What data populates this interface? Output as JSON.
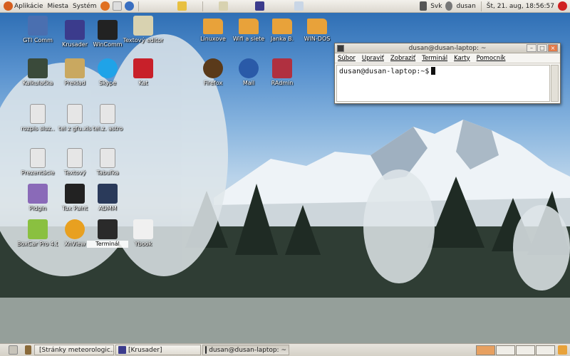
{
  "top_panel": {
    "menus": [
      "Aplikácie",
      "Miesta",
      "Systém"
    ],
    "keyboard_layout": "Svk",
    "user": "dusan",
    "clock": "Št, 21. aug, 18:56:57"
  },
  "desktop": {
    "icons": [
      {
        "label": "GTI Comm",
        "icon": "gti-comm-icon",
        "color": "#4a6fb0"
      },
      {
        "label": "Krusader",
        "icon": "krusader-icon",
        "color": "#3b3b8c"
      },
      {
        "label": "WinComm",
        "icon": "wincomm-icon",
        "color": "#222222"
      },
      {
        "label": "Textový editor",
        "icon": "text-editor-icon",
        "color": "#d8d2b0"
      },
      {
        "label": "Linuxove",
        "icon": "folder-icon",
        "color": "#e8a23a"
      },
      {
        "label": "Wifi a siete",
        "icon": "folder-icon",
        "color": "#e8a23a"
      },
      {
        "label": "Janka B.",
        "icon": "folder-icon",
        "color": "#e8a23a"
      },
      {
        "label": "WIN-DOS",
        "icon": "folder-icon",
        "color": "#e8a23a"
      },
      {
        "label": "Kalkulačka",
        "icon": "calculator-icon",
        "color": "#3a4a3a"
      },
      {
        "label": "Preklad",
        "icon": "translate-icon",
        "color": "#c9a860"
      },
      {
        "label": "Skype",
        "icon": "skype-icon",
        "color": "#1fa3e8"
      },
      {
        "label": "Kat",
        "icon": "kat-icon",
        "color": "#c8202a"
      },
      {
        "label": "Firefox",
        "icon": "firefox-icon",
        "color": "#5a3a1a"
      },
      {
        "label": "Mail",
        "icon": "mail-icon",
        "color": "#2a5aa8"
      },
      {
        "label": "RAdmin",
        "icon": "radmin-icon",
        "color": "#b03040"
      },
      {
        "label": "rozpis sluz..",
        "icon": "document-icon",
        "color": "#e6e6e6"
      },
      {
        "label": "tel z gfu.xls",
        "icon": "spreadsheet-icon",
        "color": "#e6e6e6"
      },
      {
        "label": "tel.z. astro",
        "icon": "document-icon",
        "color": "#e6e6e6"
      },
      {
        "label": "Prezentácie",
        "icon": "presentation-icon",
        "color": "#e6e6e6"
      },
      {
        "label": "Textový",
        "icon": "writer-icon",
        "color": "#e6e6e6"
      },
      {
        "label": "Tabuľka",
        "icon": "calc-icon",
        "color": "#e6e6e6"
      },
      {
        "label": "Pidgin",
        "icon": "pidgin-icon",
        "color": "#8a6ab8"
      },
      {
        "label": "Tux Paint",
        "icon": "tuxpaint-icon",
        "color": "#222222"
      },
      {
        "label": "ADMM",
        "icon": "admm-icon",
        "color": "#2a3a5a"
      },
      {
        "label": "BoxCar Pro 4.0",
        "icon": "boxcar-icon",
        "color": "#8ac040"
      },
      {
        "label": "XnView",
        "icon": "xnview-icon",
        "color": "#e8a020"
      },
      {
        "label": "Terminál",
        "icon": "terminal-icon",
        "color": "#2a2a2a"
      },
      {
        "label": "Ybook",
        "icon": "ybook-icon",
        "color": "#f0f0f0"
      }
    ]
  },
  "terminal": {
    "title": "dusan@dusan-laptop: ~",
    "menu": [
      "Súbor",
      "Upraviť",
      "Zobraziť",
      "Terminál",
      "Karty",
      "Pomocník"
    ],
    "prompt": "dusan@dusan-laptop:~$"
  },
  "taskbar": {
    "tasks": [
      {
        "label": "[Stránky meteorologic...",
        "icon": "firefox-icon"
      },
      {
        "label": "[Krusader]",
        "icon": "krusader-icon"
      },
      {
        "label": "dusan@dusan-laptop: ~",
        "icon": "terminal-icon"
      }
    ]
  }
}
